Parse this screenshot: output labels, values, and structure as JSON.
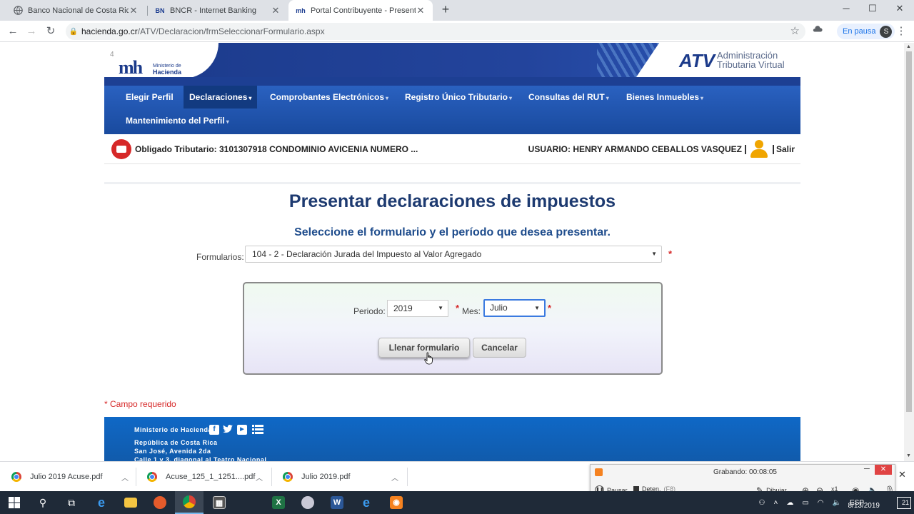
{
  "browser": {
    "tabs": [
      {
        "title": "Banco Nacional de Costa Rica",
        "icon": "globe-icon"
      },
      {
        "title": "BNCR - Internet Banking",
        "icon": "bn-logo-icon",
        "icon_text": "BN"
      },
      {
        "title": "Portal Contribuyente - Presentar",
        "icon": "mh-logo-icon",
        "icon_text": "mh"
      }
    ],
    "active_tab": 2,
    "url_host": "hacienda.go.cr",
    "url_path": "/ATV/Declaracion/frmSeleccionarFormulario.aspx",
    "profile_status": "En pausa",
    "profile_initial": "S"
  },
  "site": {
    "corner_number": "4",
    "logo_main": "mh",
    "logo_sub_1": "Ministerio de",
    "logo_sub_2": "Hacienda",
    "atv_mark": "ATV",
    "atv_line_1": "Administración",
    "atv_line_2": "Tributaria Virtual",
    "menu": [
      "Elegir Perfil",
      "Declaraciones",
      "Comprobantes Electrónicos",
      "Registro Único Tributario",
      "Consultas del RUT",
      "Bienes Inmuebles",
      "Mantenimiento del Perfil"
    ],
    "obligado_tributario": "Obligado Tributario: 3101307918 CONDOMINIO AVICENIA NUMERO ...",
    "usuario": "USUARIO: HENRY ARMANDO CEBALLOS VASQUEZ",
    "salir": "Salir"
  },
  "form": {
    "title": "Presentar declaraciones de impuestos",
    "subtitle": "Seleccione el formulario y el período que desea presentar.",
    "formularios_label": "Formularios:",
    "formularios_value": "104 - 2 - Declaración Jurada del Impuesto al Valor Agregado",
    "periodo_label": "Periodo:",
    "periodo_value": "2019",
    "mes_label": "Mes:",
    "mes_value": "Julio",
    "required_mark": "*",
    "btn_llenar": "Llenar formulario",
    "btn_cancelar": "Cancelar",
    "required_note": "* Campo requerido"
  },
  "footer": {
    "ministry": "Ministerio de Hacienda",
    "address_1": "República de Costa Rica",
    "address_2": "San José, Avenida 2da",
    "address_3": "Calle 1 y 3, diagonal al Teatro Nacional"
  },
  "downloads": [
    {
      "name": "Julio 2019 Acuse.pdf"
    },
    {
      "name": "Acuse_125_1_1251....pdf"
    },
    {
      "name": "Julio 2019.pdf"
    }
  ],
  "recorder": {
    "status": "Grabando:",
    "time": "00:08:05",
    "pause": "Pausar",
    "stop": "Deten.",
    "stop_key": "(F8)",
    "draw": "Dibujar",
    "zoom": "x1"
  },
  "taskbar": {
    "language": "ESP",
    "date": "8/13/2019",
    "notifications": "21"
  },
  "colors": {
    "brand_blue": "#1b3a8a",
    "menu_blue": "#2a61c0",
    "title_blue": "#1d3a70",
    "required_red": "#d62828",
    "footer_blue": "#0f68c6"
  }
}
